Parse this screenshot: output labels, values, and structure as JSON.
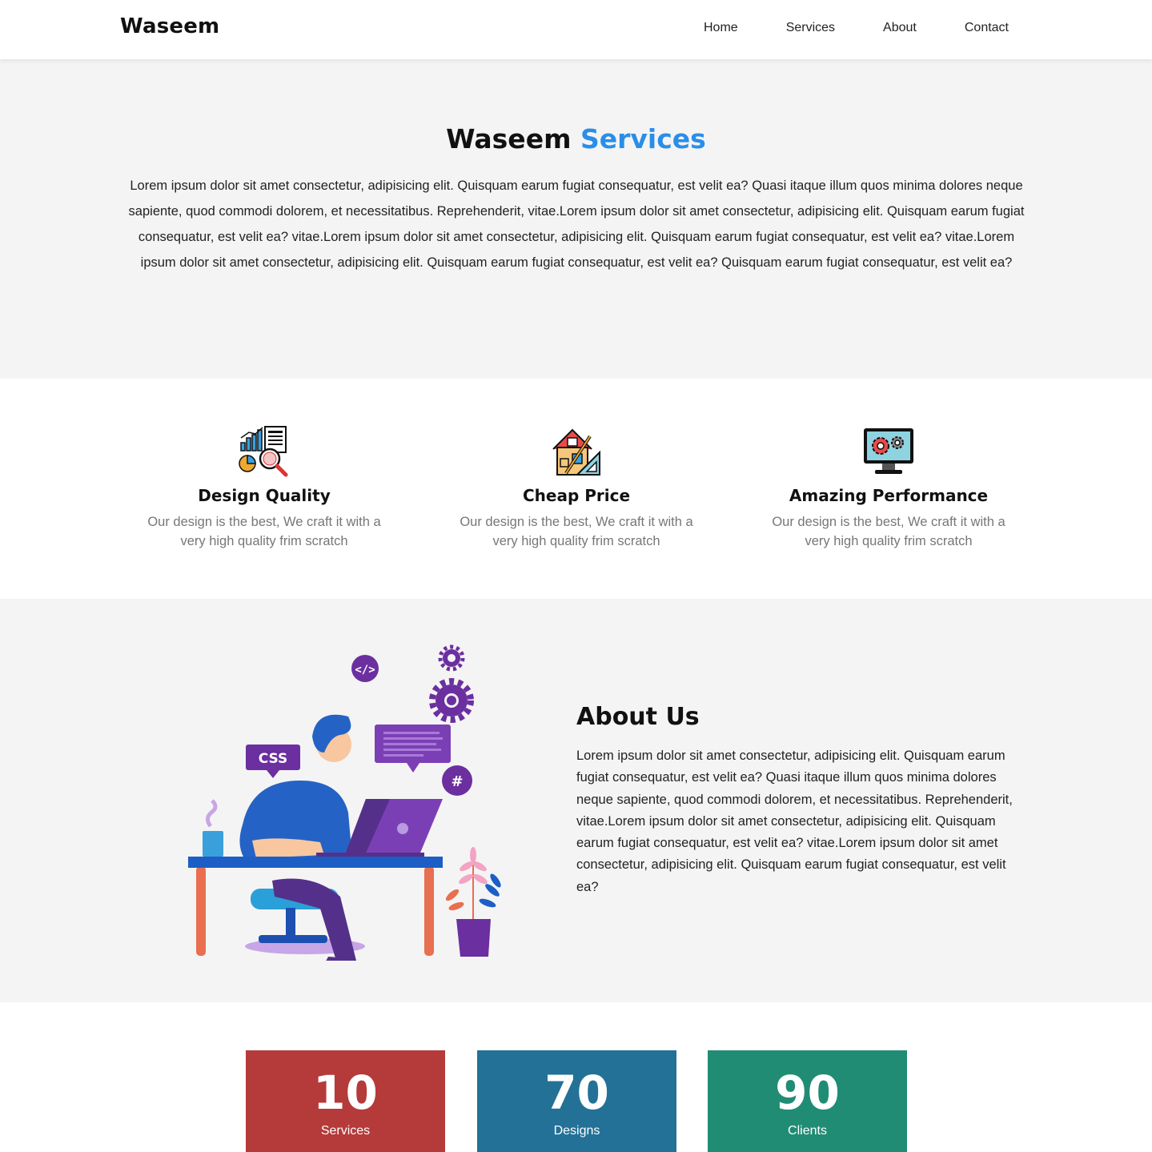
{
  "nav": {
    "brand": "Waseem",
    "links": [
      "Home",
      "Services",
      "About",
      "Contact"
    ]
  },
  "hero": {
    "title_main": "Waseem",
    "title_accent": "Services",
    "paragraph": "Lorem ipsum dolor sit amet consectetur, adipisicing elit. Quisquam earum fugiat consequatur, est velit ea? Quasi itaque illum quos minima dolores neque sapiente, quod commodi dolorem, et necessitatibus. Reprehenderit, vitae.Lorem ipsum dolor sit amet consectetur, adipisicing elit. Quisquam earum fugiat consequatur, est velit ea? vitae.Lorem ipsum dolor sit amet consectetur, adipisicing elit. Quisquam earum fugiat consequatur, est velit ea? vitae.Lorem ipsum dolor sit amet consectetur, adipisicing elit. Quisquam earum fugiat consequatur, est velit ea? Quisquam earum fugiat consequatur, est velit ea?"
  },
  "features": [
    {
      "icon": "analytics-magnifier-icon",
      "title": "Design Quality",
      "text": "Our design is the best, We craft it with a very high quality frim scratch"
    },
    {
      "icon": "house-design-tools-icon",
      "title": "Cheap Price",
      "text": "Our design is the best, We craft it with a very high quality frim scratch"
    },
    {
      "icon": "monitor-gears-icon",
      "title": "Amazing Performance",
      "text": "Our design is the best, We craft it with a very high quality frim scratch"
    }
  ],
  "about": {
    "title": "About Us",
    "paragraph": "Lorem ipsum dolor sit amet consectetur, adipisicing elit. Quisquam earum fugiat consequatur, est velit ea? Quasi itaque illum quos minima dolores neque sapiente, quod commodi dolorem, et necessitatibus. Reprehenderit, vitae.Lorem ipsum dolor sit amet consectetur, adipisicing elit. Quisquam earum fugiat consequatur, est velit ea? vitae.Lorem ipsum dolor sit amet consectetur, adipisicing elit. Quisquam earum fugiat consequatur, est velit ea?",
    "illustration": {
      "css_label": "CSS",
      "code_label": "</>",
      "hash_label": "#"
    }
  },
  "stats": [
    {
      "value": "10",
      "label": "Services",
      "color": "#b53a3a"
    },
    {
      "value": "70",
      "label": "Designs",
      "color": "#237196"
    },
    {
      "value": "90",
      "label": "Clients",
      "color": "#218c74"
    }
  ],
  "colors": {
    "accent": "#2a8ee8",
    "section_bg": "#f4f4f4",
    "muted_text": "#777777"
  }
}
